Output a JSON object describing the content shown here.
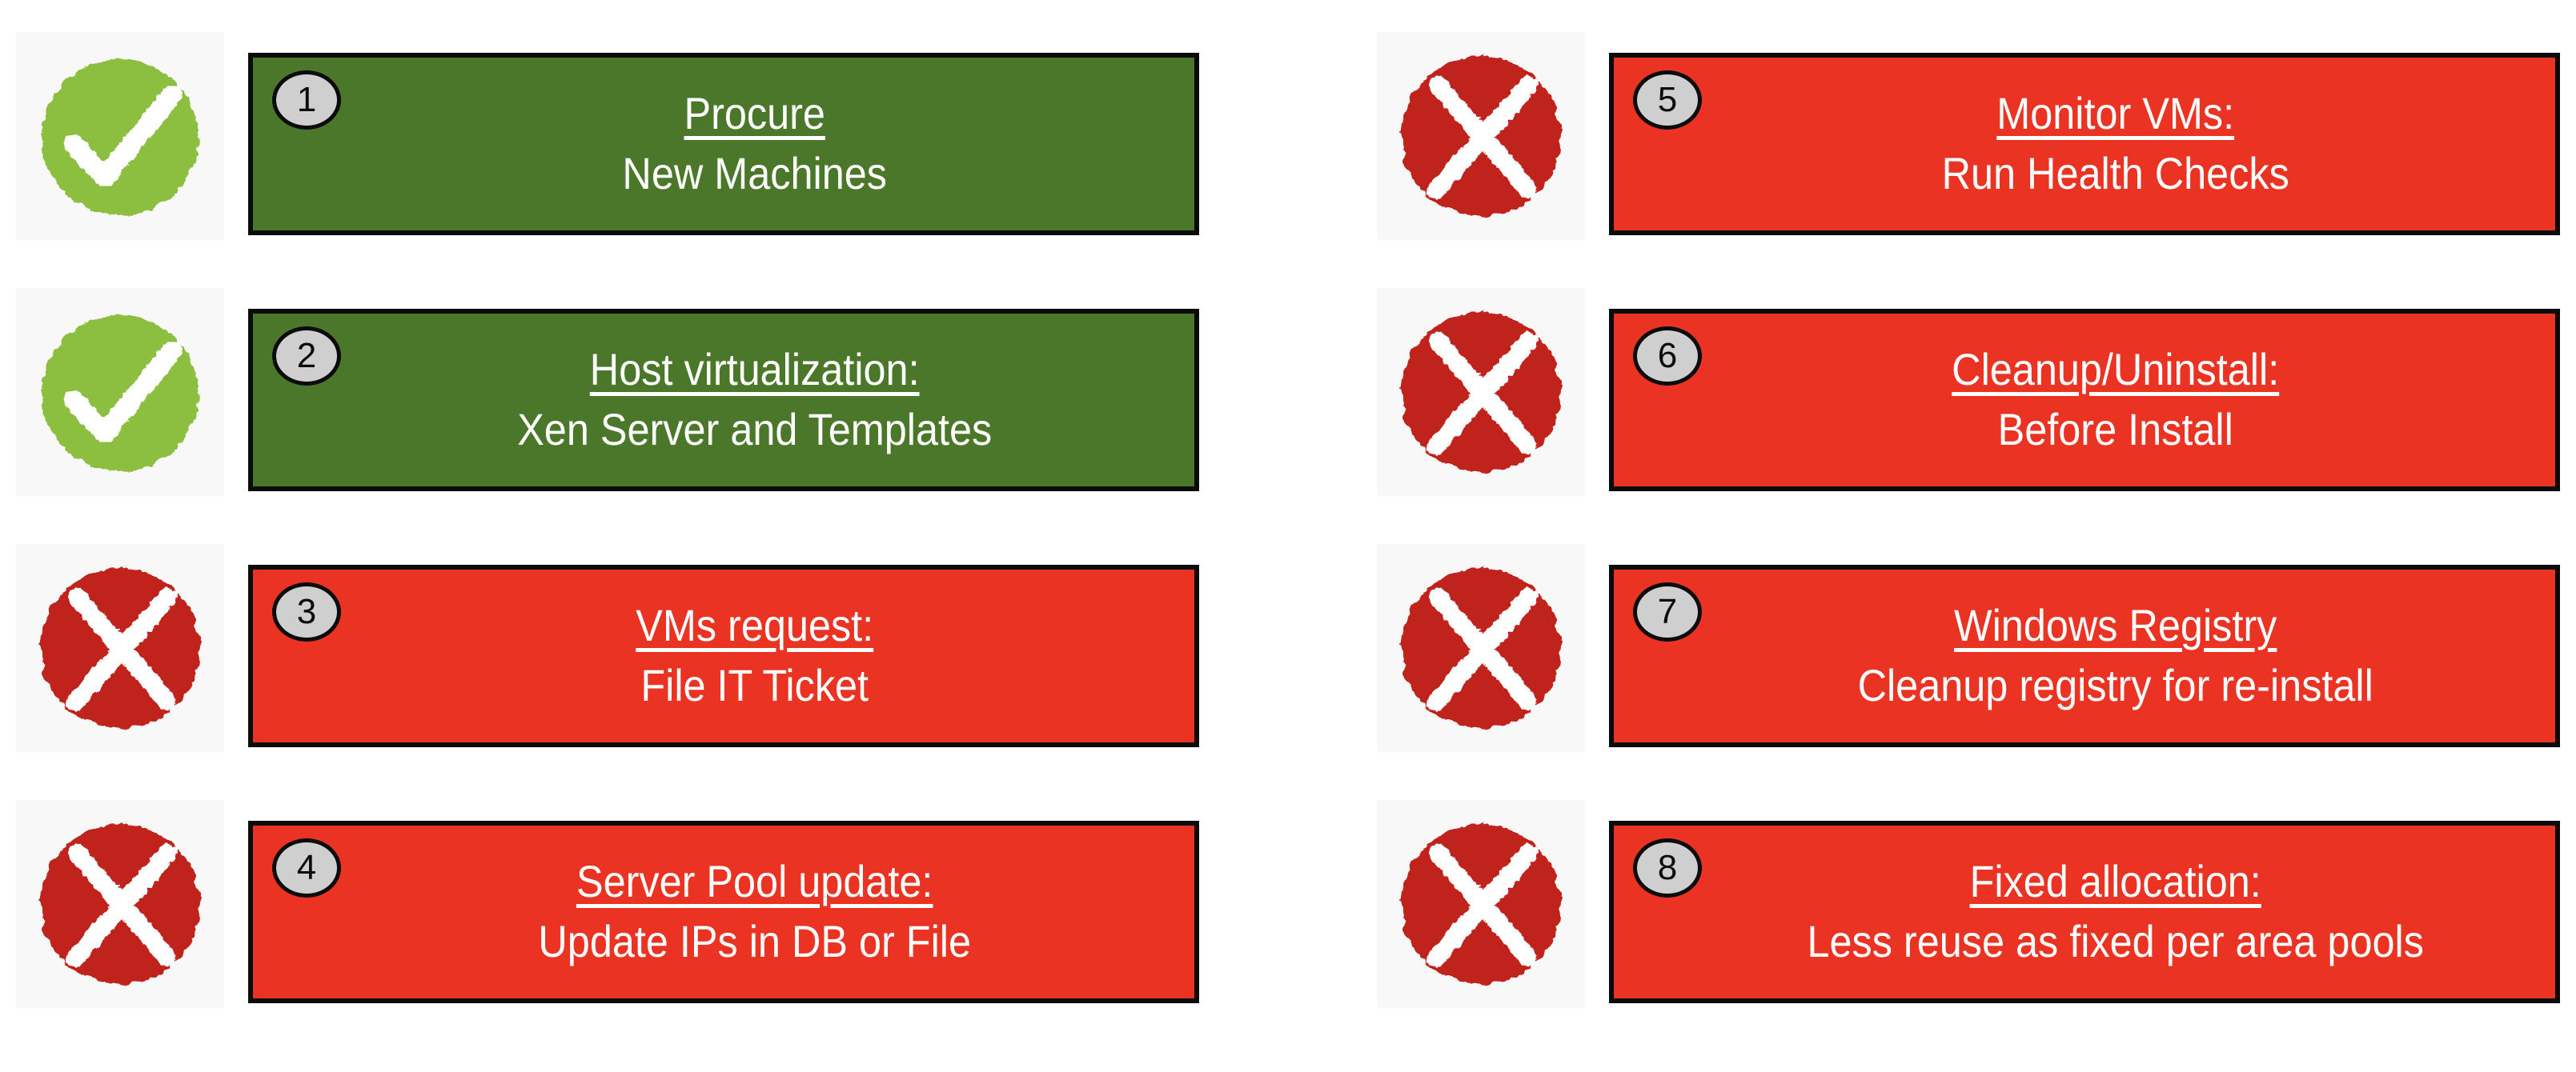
{
  "page": {
    "background": "#ffffff",
    "columns": 2,
    "rows_per_column": 4
  },
  "colors": {
    "green_card": "#4a7729",
    "red_card": "#ea3323",
    "check_circle": "#8cbe3f",
    "cross_circle": "#c0241c",
    "bubble_fill": "#cfcfcf",
    "bubble_border": "#0b0b0b",
    "card_border": "#0b0b0b",
    "card_text": "#ffffff",
    "icon_backdrop": "#f8f8f8"
  },
  "items": [
    {
      "number": "1",
      "status": "check",
      "status_icon": "green-check-circle-icon",
      "card_color": "green",
      "title": "Procure",
      "subtitle": "New Machines",
      "column": 0,
      "row": 0
    },
    {
      "number": "2",
      "status": "check",
      "status_icon": "green-check-circle-icon",
      "card_color": "green",
      "title": "Host virtualization:",
      "subtitle": "Xen Server and Templates",
      "column": 0,
      "row": 1
    },
    {
      "number": "3",
      "status": "cross",
      "status_icon": "red-cross-circle-icon",
      "card_color": "red",
      "title": "VMs request:",
      "subtitle": "File IT Ticket",
      "column": 0,
      "row": 2
    },
    {
      "number": "4",
      "status": "cross",
      "status_icon": "red-cross-circle-icon",
      "card_color": "red",
      "title": "Server Pool update:",
      "subtitle": "Update IPs in DB or File",
      "column": 0,
      "row": 3
    },
    {
      "number": "5",
      "status": "cross",
      "status_icon": "red-cross-circle-icon",
      "card_color": "red",
      "title": "Monitor VMs:",
      "subtitle": "Run Health Checks",
      "column": 1,
      "row": 0
    },
    {
      "number": "6",
      "status": "cross",
      "status_icon": "red-cross-circle-icon",
      "card_color": "red",
      "title": "Cleanup/Uninstall:",
      "subtitle": "Before Install",
      "column": 1,
      "row": 1
    },
    {
      "number": "7",
      "status": "cross",
      "status_icon": "red-cross-circle-icon",
      "card_color": "red",
      "title": "Windows Registry",
      "subtitle": "Cleanup registry for re-install",
      "column": 1,
      "row": 2
    },
    {
      "number": "8",
      "status": "cross",
      "status_icon": "red-cross-circle-icon",
      "card_color": "red",
      "title": "Fixed allocation:",
      "subtitle": "Less reuse as fixed per area pools",
      "column": 1,
      "row": 3
    }
  ],
  "layout": {
    "column_left_x": [
      20,
      1720
    ],
    "row_tops": [
      40,
      360,
      680,
      1000
    ],
    "card_widths": [
      1188,
      1188
    ]
  }
}
